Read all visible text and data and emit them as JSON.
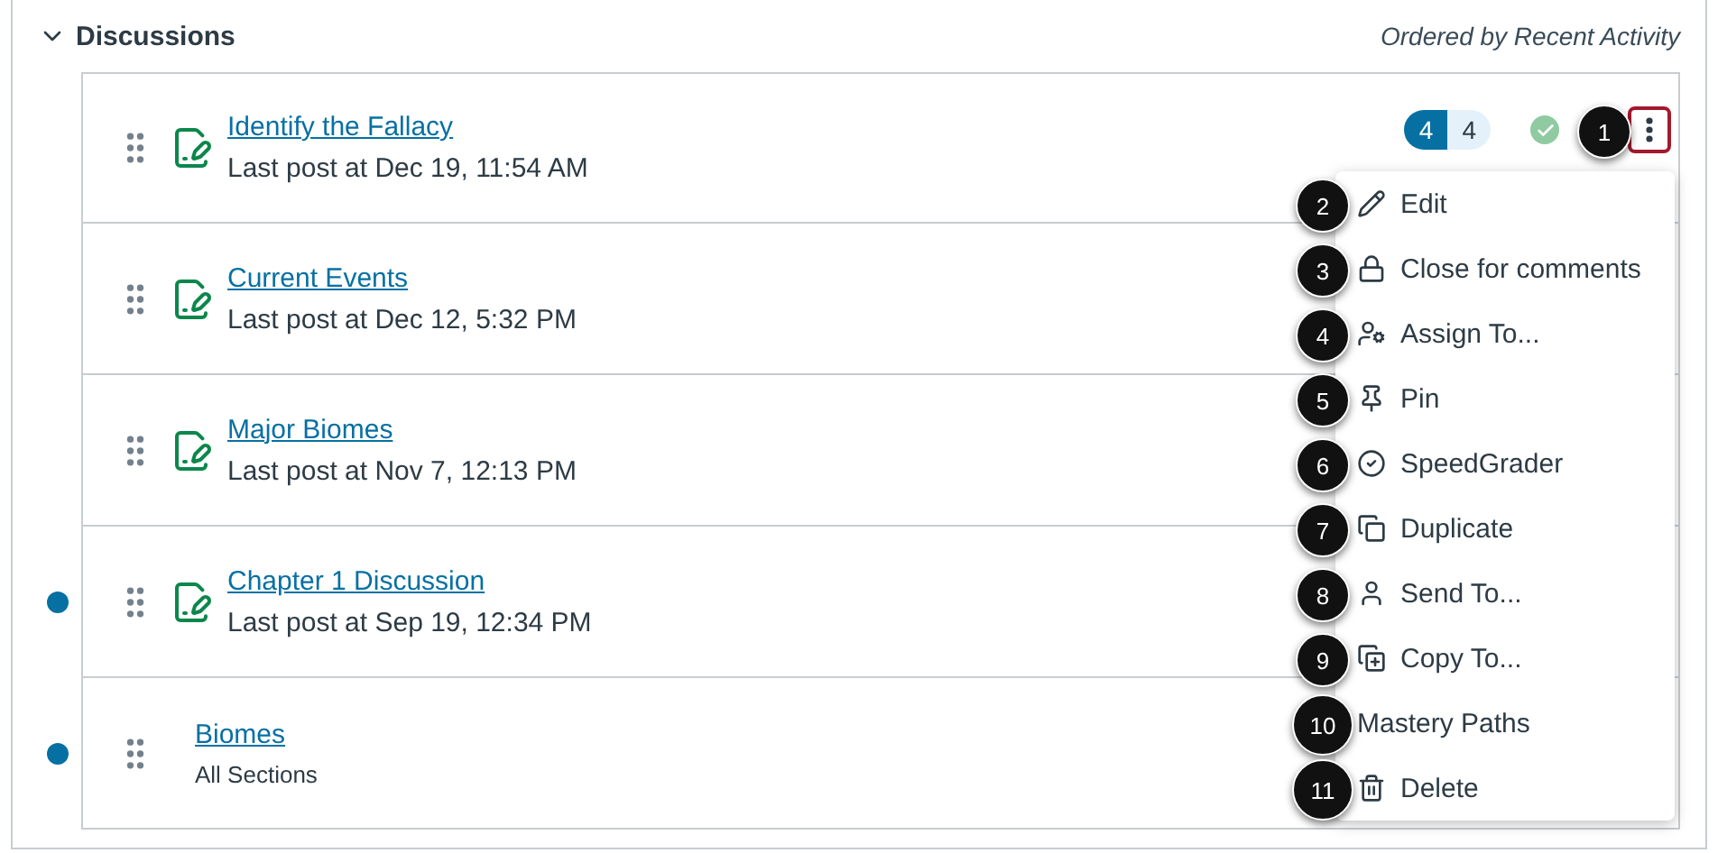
{
  "section": {
    "title": "Discussions",
    "expanded": true,
    "sort_note": "Ordered by Recent Activity"
  },
  "discussions": [
    {
      "title": "Identify the Fallacy",
      "subtitle": "Last post at Dec 19, 11:54 AM",
      "unread": false,
      "kind": "discussion",
      "replies": {
        "unread": "4",
        "total": "4"
      },
      "published": true,
      "menu_open": true
    },
    {
      "title": "Current Events",
      "subtitle": "Last post at Dec 12, 5:32 PM",
      "unread": false,
      "kind": "discussion",
      "menu_open": false
    },
    {
      "title": "Major Biomes",
      "subtitle": "Last post at Nov 7, 12:13 PM",
      "unread": false,
      "kind": "discussion",
      "menu_open": false
    },
    {
      "title": "Chapter 1 Discussion",
      "subtitle": "Last post at Sep 19, 12:34 PM",
      "unread": true,
      "kind": "discussion",
      "menu_open": false
    },
    {
      "title": "Biomes",
      "subtitle": "All Sections",
      "unread": true,
      "kind": "plain",
      "menu_open": false
    }
  ],
  "menu": [
    {
      "label": "Edit",
      "callout": "2"
    },
    {
      "label": "Close for comments",
      "callout": "3"
    },
    {
      "label": "Assign To...",
      "callout": "4"
    },
    {
      "label": "Pin",
      "callout": "5"
    },
    {
      "label": "SpeedGrader",
      "callout": "6"
    },
    {
      "label": "Duplicate",
      "callout": "7"
    },
    {
      "label": "Send To...",
      "callout": "8"
    },
    {
      "label": "Copy To...",
      "callout": "9"
    },
    {
      "label": "Mastery Paths",
      "callout": "10"
    },
    {
      "label": "Delete",
      "callout": "11"
    }
  ],
  "menu_button_callout": "1"
}
